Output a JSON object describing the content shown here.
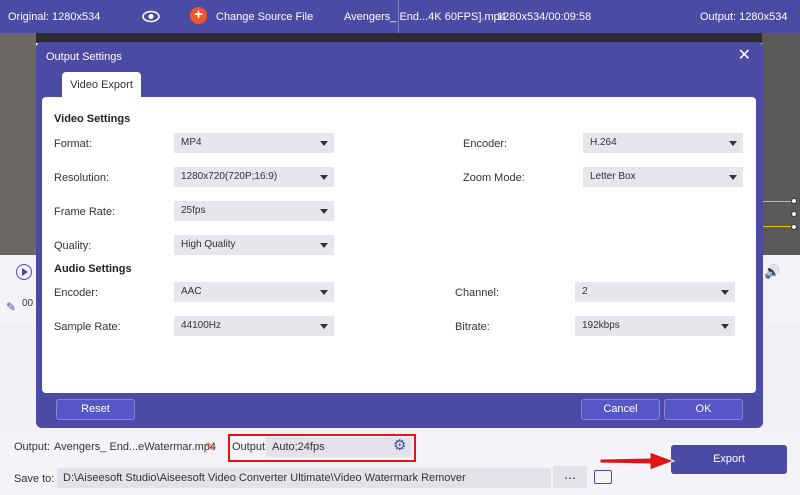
{
  "topbar": {
    "original_label": "Original: 1280x534",
    "change_source": "Change Source File",
    "file_name": "Avengers_ End...4K 60FPS].mp4",
    "file_info": "1280x534/00:09:58",
    "output_label": "Output: 1280x534"
  },
  "timeline": {
    "time_fragment": "00"
  },
  "dialog": {
    "title": "Output Settings",
    "tab": "Video Export",
    "video_section": "Video Settings",
    "audio_section": "Audio Settings",
    "fields": {
      "format": {
        "label": "Format:",
        "value": "MP4"
      },
      "encoder": {
        "label": "Encoder:",
        "value": "H.264"
      },
      "resolution": {
        "label": "Resolution:",
        "value": "1280x720(720P;16:9)"
      },
      "zoom_mode": {
        "label": "Zoom Mode:",
        "value": "Letter Box"
      },
      "frame_rate": {
        "label": "Frame Rate:",
        "value": "25fps"
      },
      "quality": {
        "label": "Quality:",
        "value": "High Quality"
      },
      "audio_encoder": {
        "label": "Encoder:",
        "value": "AAC"
      },
      "channel": {
        "label": "Channel:",
        "value": "2"
      },
      "sample_rate": {
        "label": "Sample Rate:",
        "value": "44100Hz"
      },
      "bitrate": {
        "label": "Bitrate:",
        "value": "192kbps"
      }
    },
    "buttons": {
      "reset": "Reset",
      "cancel": "Cancel",
      "ok": "OK"
    }
  },
  "bottom": {
    "output_label": "Output:",
    "output_file": "Avengers_ End...eWatermar.mp4",
    "output2_label": "Output:",
    "output2_value": "Auto;24fps",
    "save_label": "Save to:",
    "save_path": "D:\\Aiseesoft Studio\\Aiseesoft Video Converter Ultimate\\Video Watermark Remover",
    "dots": "...",
    "export": "Export"
  },
  "colors": {
    "accent": "#4b4ba6",
    "highlight": "#e0151a",
    "plus": "#f0582c"
  }
}
